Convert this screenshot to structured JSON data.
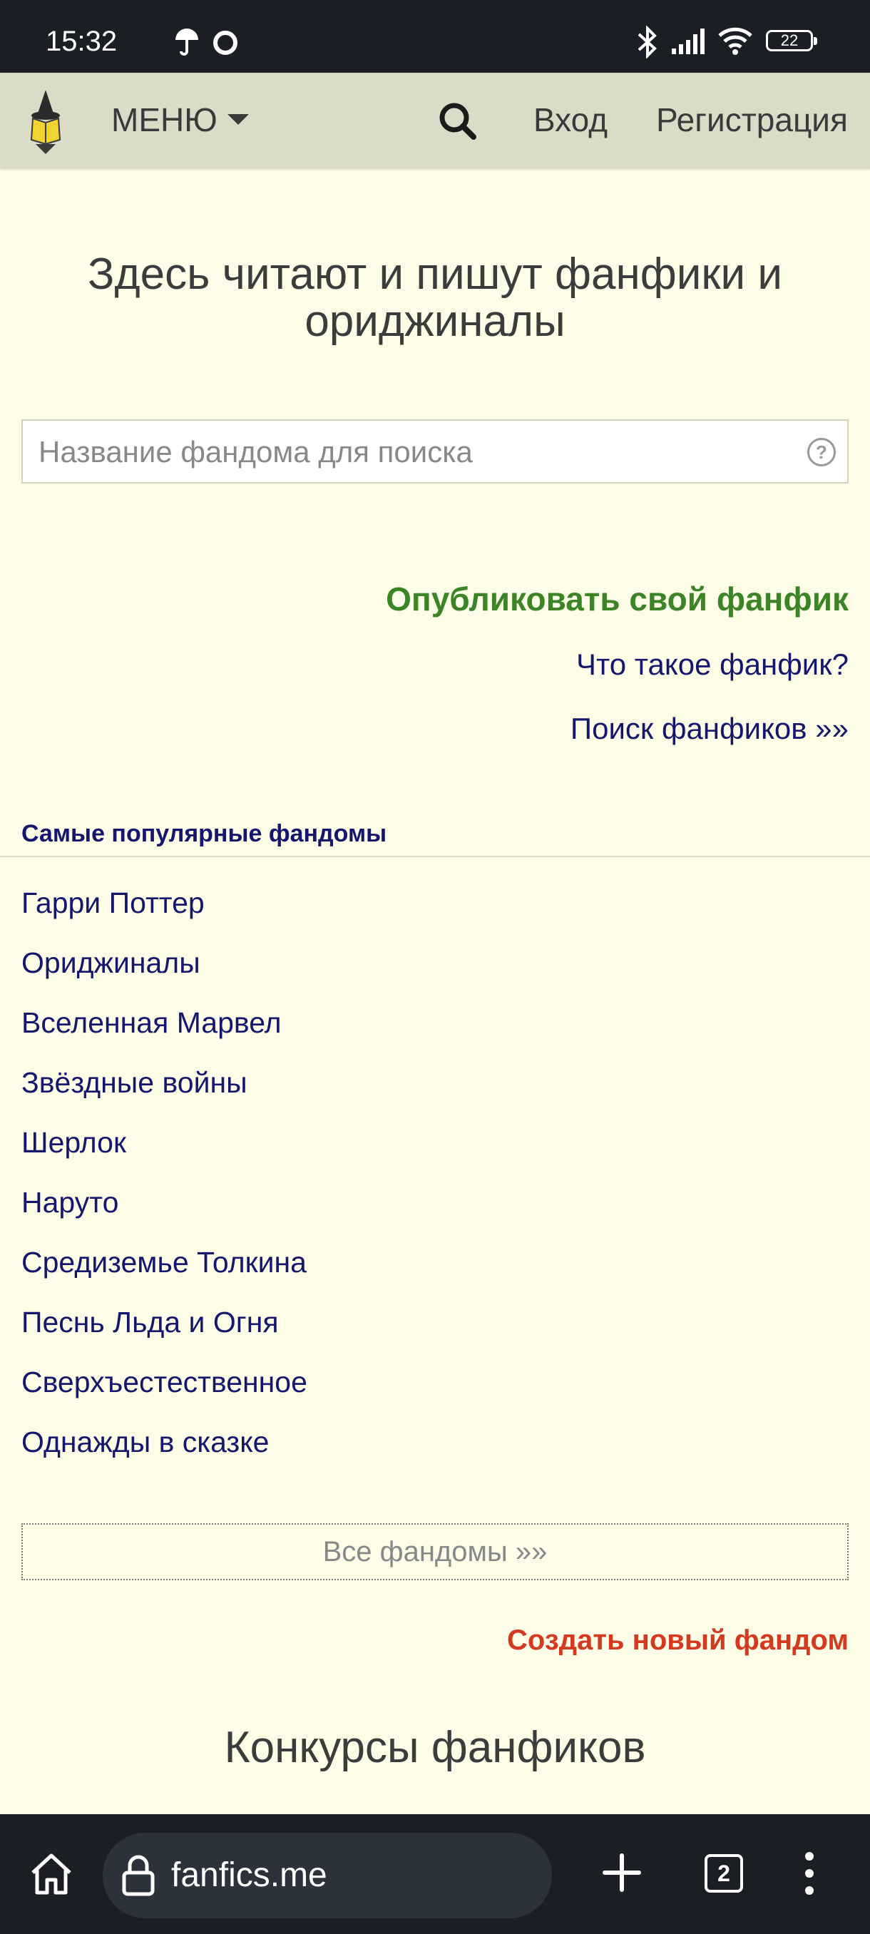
{
  "status_bar": {
    "time": "15:32",
    "battery": "22",
    "icons": [
      "umbrella-icon",
      "circle-icon",
      "bluetooth-icon",
      "signal-icon",
      "wifi-icon",
      "battery-icon"
    ]
  },
  "header": {
    "menu_label": "МЕНЮ",
    "login_label": "Вход",
    "register_label": "Регистрация"
  },
  "main": {
    "hero_title": "Здесь читают и пишут фанфики и ориджиналы",
    "search_placeholder": "Название фандома для поиска",
    "help_glyph": "?",
    "publish_label": "Опубликовать свой фанфик",
    "what_is_label": "Что такое фанфик?",
    "search_fics_label": "Поиск фанфиков »»",
    "popular_title": "Самые популярные фандомы",
    "fandoms": [
      "Гарри Поттер",
      "Ориджиналы",
      "Вселенная Марвел",
      "Звёздные войны",
      "Шерлок",
      "Наруто",
      "Средиземье Толкина",
      "Песнь Льда и Огня",
      "Сверхъестественное",
      "Однажды в сказке"
    ],
    "all_fandoms_label": "Все фандомы »»",
    "create_fandom_label": "Создать новый фандом",
    "contests_title": "Конкурсы фанфиков"
  },
  "browser": {
    "url": "fanfics.me",
    "tab_count": "2"
  },
  "colors": {
    "page_bg": "#fdfde8",
    "header_bg": "#dbdcc8",
    "link": "#15166e",
    "publish": "#3c8527",
    "create": "#d5391f",
    "system_bar": "#1b1f25"
  }
}
